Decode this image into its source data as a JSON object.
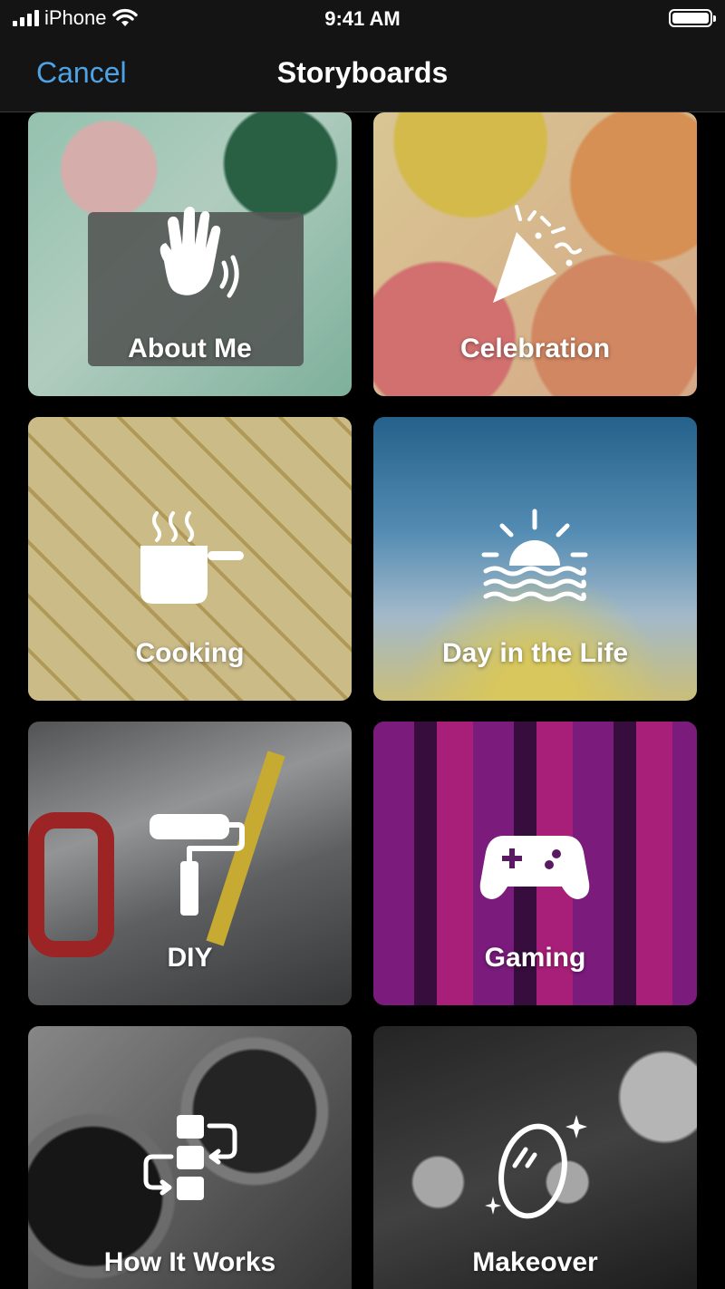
{
  "status_bar": {
    "carrier": "iPhone",
    "time": "9:41 AM",
    "battery_level": 1.0
  },
  "nav": {
    "cancel_label": "Cancel",
    "title": "Storyboards",
    "accent_color": "#4da3e6"
  },
  "tiles": [
    {
      "label": "About Me",
      "icon": "waving-hand-icon"
    },
    {
      "label": "Celebration",
      "icon": "party-popper-icon"
    },
    {
      "label": "Cooking",
      "icon": "cooking-pot-icon"
    },
    {
      "label": "Day in the Life",
      "icon": "sunrise-icon"
    },
    {
      "label": "DIY",
      "icon": "paint-roller-icon"
    },
    {
      "label": "Gaming",
      "icon": "game-controller-icon"
    },
    {
      "label": "How It Works",
      "icon": "process-steps-icon"
    },
    {
      "label": "Makeover",
      "icon": "mirror-sparkle-icon"
    }
  ]
}
